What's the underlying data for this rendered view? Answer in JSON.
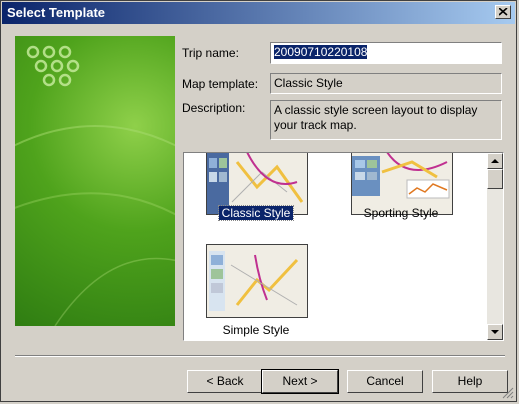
{
  "window": {
    "title": "Select Template",
    "close_glyph": "close-icon"
  },
  "form": {
    "trip_name_label": "Trip name:",
    "trip_name_value": "20090710220108",
    "map_template_label": "Map template:",
    "map_template_value": "Classic Style",
    "description_label": "Description:",
    "description_value": "A classic style screen layout to display your track map."
  },
  "templates": [
    {
      "name": "Classic Style",
      "selected": true
    },
    {
      "name": "Sporting Style",
      "selected": false
    },
    {
      "name": "Simple Style",
      "selected": false
    }
  ],
  "buttons": {
    "back": "< Back",
    "next": "Next >",
    "cancel": "Cancel",
    "help": "Help"
  },
  "colors": {
    "title_bar": "#0a246a",
    "banner_green": "#4fa31c",
    "selection": "#0a246a"
  }
}
